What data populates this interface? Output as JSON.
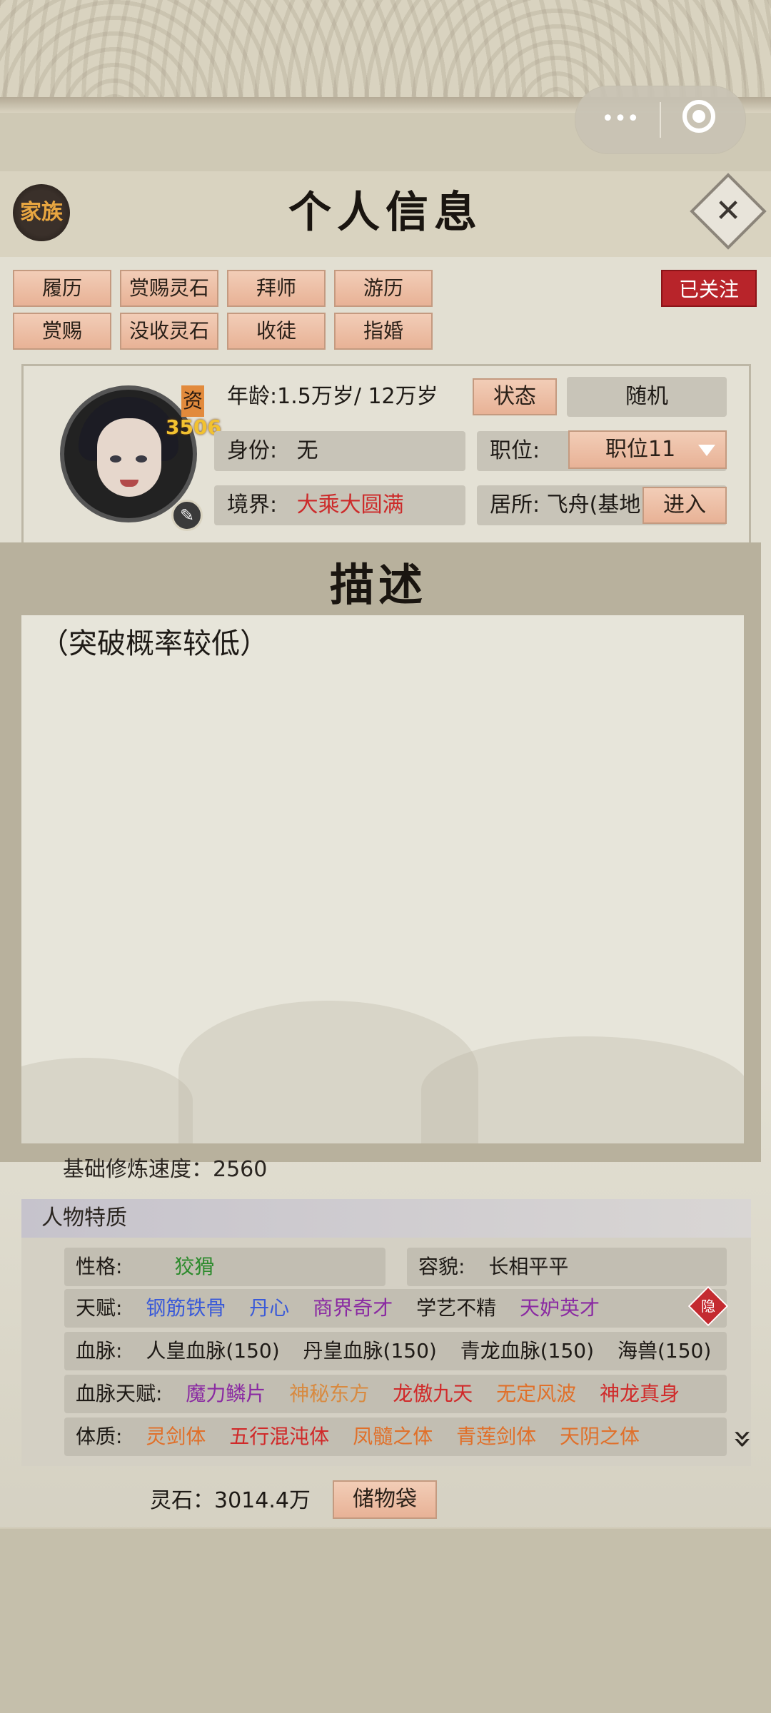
{
  "header": {
    "title": "个人信息",
    "family_label": "家族",
    "capsule_more": "•••"
  },
  "actions": {
    "row1": [
      "履历",
      "赏赐灵石",
      "拜师",
      "游历"
    ],
    "row2": [
      "赏赐",
      "没收灵石",
      "收徒",
      "指婚"
    ],
    "follow_label": "已关注"
  },
  "profile": {
    "aptitude_label": "资",
    "aptitude_value": "3506",
    "age": "年龄:1.5万岁/ 12万岁",
    "status_button": "状态",
    "random_button": "随机",
    "identity_label": "身份:",
    "identity_value": "无",
    "position_label": "职位:",
    "position_value": "职位11",
    "realm_label": "境界:",
    "realm_value": "大乘大圆满",
    "residence": "居所: 飞舟(基地",
    "enter_button": "进入"
  },
  "modal": {
    "title": "描述",
    "text": "（突破概率较低）"
  },
  "cultivation": {
    "base_speed": "基础修炼速度：2560"
  },
  "traits": {
    "section_title": "人物特质",
    "personality_label": "性格:",
    "personality_value": "狡猾",
    "appearance_label": "容貌:",
    "appearance_value": "长相平平",
    "talent_label": "天赋:",
    "talents": [
      {
        "text": "钢筋铁骨",
        "color": "#3a5ad8"
      },
      {
        "text": "丹心",
        "color": "#3a5ad8"
      },
      {
        "text": "商界奇才",
        "color": "#8a2aa2"
      },
      {
        "text": "学艺不精",
        "color": "#1e1a16"
      },
      {
        "text": "天妒英才",
        "color": "#8a2aa2"
      }
    ],
    "hide_label": "隐",
    "bloodline_label": "血脉:",
    "bloodlines": [
      "人皇血脉(150)",
      "丹皇血脉(150)",
      "青龙血脉(150)",
      "海兽(150)"
    ],
    "bloodline_talent_label": "血脉天赋:",
    "bloodline_talents": [
      {
        "text": "魔力鳞片",
        "color": "#8a2aa2"
      },
      {
        "text": "神秘东方",
        "color": "#d88a40"
      },
      {
        "text": "龙傲九天",
        "color": "#d02a2a"
      },
      {
        "text": "无定风波",
        "color": "#e0702a"
      },
      {
        "text": "神龙真身",
        "color": "#d02a2a"
      }
    ],
    "physique_label": "体质:",
    "physiques": [
      {
        "text": "灵剑体",
        "color": "#e0702a"
      },
      {
        "text": "五行混沌体",
        "color": "#d02a2a"
      },
      {
        "text": "凤髓之体",
        "color": "#e0702a"
      },
      {
        "text": "青莲剑体",
        "color": "#e0702a"
      },
      {
        "text": "天阴之体",
        "color": "#e0702a"
      }
    ]
  },
  "footer": {
    "spirit_stones": "灵石：3014.4万",
    "storage_button": "储物袋"
  }
}
